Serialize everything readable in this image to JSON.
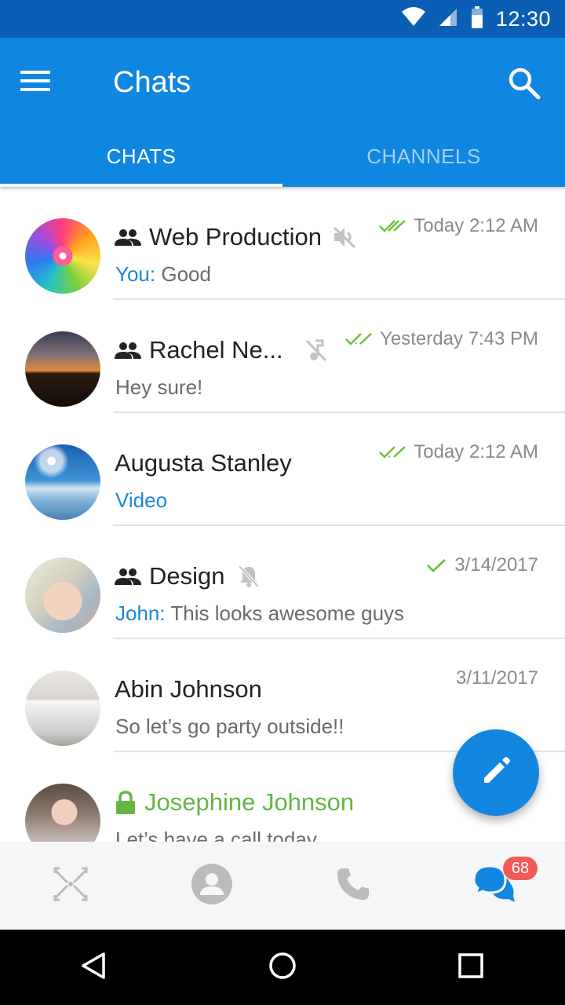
{
  "status_bar": {
    "time": "12:30"
  },
  "app_bar": {
    "title": "Chats"
  },
  "tabs": [
    {
      "label": "CHATS",
      "active": true
    },
    {
      "label": "CHANNELS",
      "active": false
    }
  ],
  "chats": [
    {
      "name": "Web Production",
      "group": true,
      "muted_icon": "volume-off-icon",
      "time": "Today 2:12 AM",
      "ticks": "double",
      "sender": "You:",
      "message": "Good",
      "avatar": "flower"
    },
    {
      "name": "Rachel Ne...",
      "group": true,
      "muted_icon": "music-off-icon",
      "time": "Yesterday 7:43 PM",
      "ticks": "double",
      "sender": "",
      "message": "Hey sure!",
      "avatar": "sunset"
    },
    {
      "name": "Augusta Stanley",
      "group": false,
      "muted_icon": "",
      "time": "Today 2:12 AM",
      "ticks": "double",
      "sender": "",
      "message": "Video",
      "avatar": "ocean"
    },
    {
      "name": "Design",
      "group": true,
      "muted_icon": "bell-off-icon",
      "time": "3/14/2017",
      "ticks": "single",
      "sender": "John:",
      "message": "This looks awesome guys",
      "avatar": "hands"
    },
    {
      "name": "Abin Johnson",
      "group": false,
      "muted_icon": "",
      "time": "3/11/2017",
      "ticks": "none",
      "sender": "",
      "message": "So let’s go party outside!!",
      "avatar": "building"
    },
    {
      "name": "Josephine Johnson",
      "group": false,
      "secure": true,
      "muted_icon": "",
      "time": "",
      "ticks": "none",
      "sender": "",
      "message": "Let’s have a call today",
      "avatar": "woman"
    }
  ],
  "bottom_nav": {
    "items": [
      "contacts-hub-icon",
      "profile-icon",
      "phone-icon",
      "chats-icon"
    ],
    "badge": "68"
  },
  "colors": {
    "status_bar": "#0a5fb4",
    "app_bar": "#0f86e0",
    "accent_blue": "#1a88d9",
    "tick_green": "#6bc43b",
    "secure_green": "#66b543",
    "badge_red": "#f25a5a"
  }
}
